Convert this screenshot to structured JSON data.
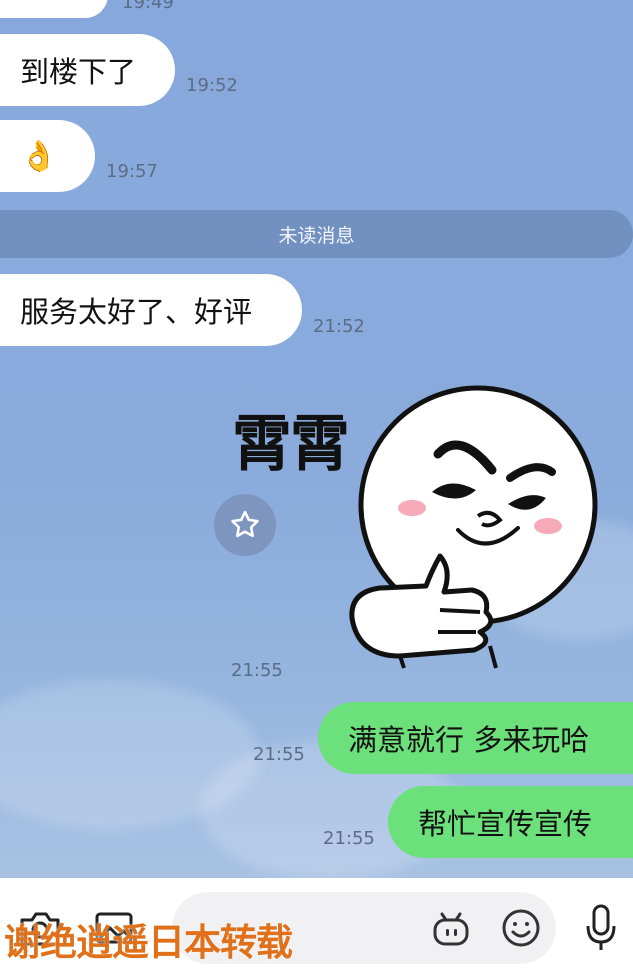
{
  "messages": {
    "prev_time": "19:49",
    "m1_text": "到楼下了",
    "m1_time": "19:52",
    "m2_emoji": "👌",
    "m2_time": "19:57",
    "unread_label": "未读消息",
    "m3_text": "服务太好了、好评",
    "m3_time": "21:52",
    "sticker_text": "霄霄",
    "sticker_time": "21:55",
    "m4_text": "满意就行 多来玩哈",
    "m4_time": "21:55",
    "m5_text": "帮忙宣传宣传",
    "m5_time": "21:55"
  },
  "watermark": "谢绝逍遥日本转载",
  "icons": {
    "star": "star-icon",
    "camera": "camera-icon",
    "image": "image-icon",
    "bot": "bot-icon",
    "emoji": "emoji-icon",
    "mic": "microphone-icon"
  },
  "colors": {
    "chat_bg": "#8aabdc",
    "incoming": "#ffffff",
    "outgoing": "#6ce07a",
    "unread_bar": "#7291c1",
    "watermark": "#e0701a"
  }
}
